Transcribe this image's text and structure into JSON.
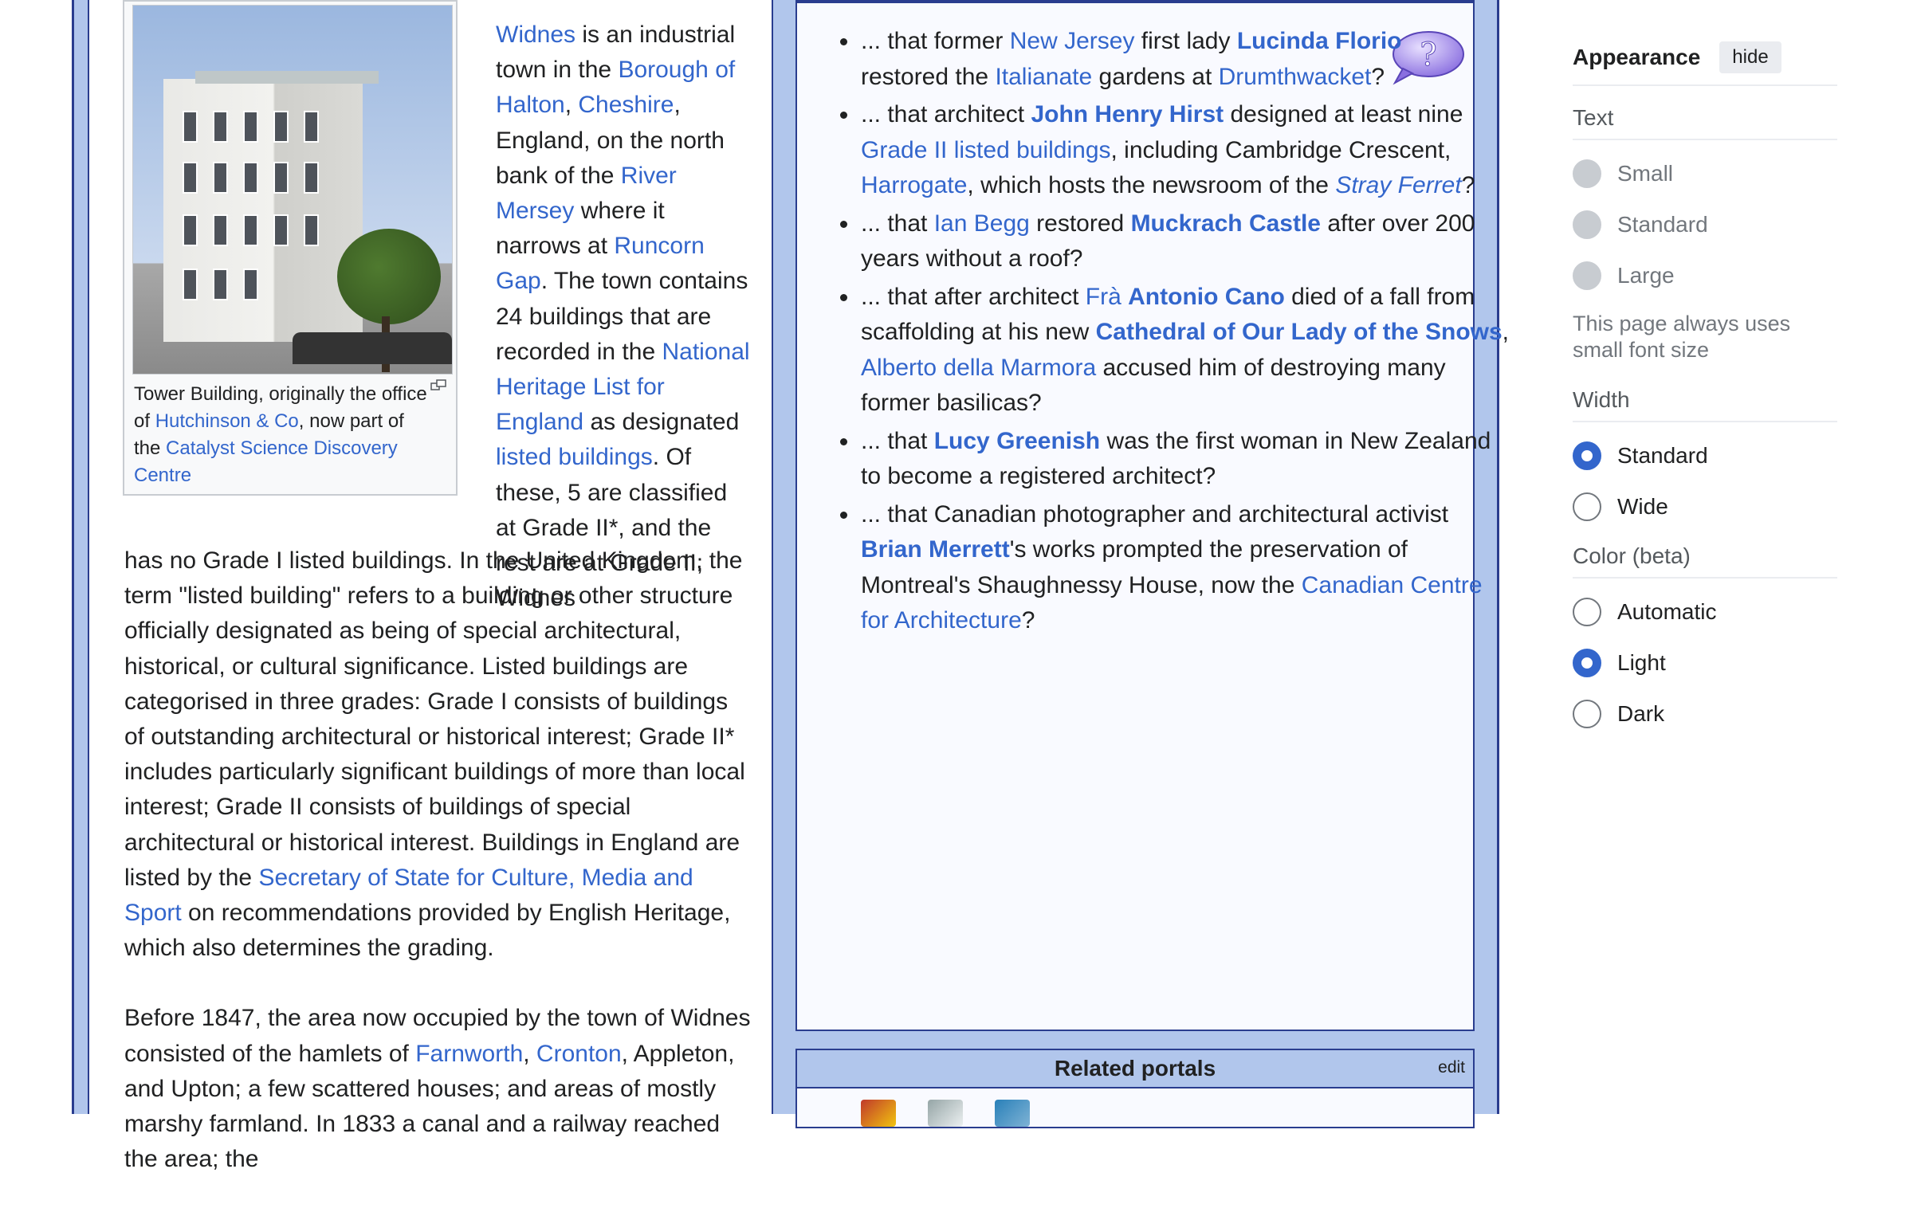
{
  "figure": {
    "caption_a": "Tower Building, originally the office of ",
    "caption_link1": "Hutchinson & Co",
    "caption_b": ", now part of the ",
    "caption_link2": "Catalyst Science Discovery Centre"
  },
  "lead": {
    "t1_link": "Widnes",
    "t1": " is an industrial town in the ",
    "t2_link": "Borough of Halton",
    "t2": ", ",
    "t3_link": "Cheshire",
    "t3": ", England, on the north bank of the ",
    "t4_link": "River Mersey",
    "t4": " where it narrows at ",
    "t5_link": "Runcorn Gap",
    "t5": ". The town contains 24 buildings that are recorded in the ",
    "t6_link": "National Heritage List for England",
    "t6": " as designated ",
    "t7_link": "listed buildings",
    "t7": ". Of these, 5 are classified at Grade II*, and the rest are at Grade II; Widnes"
  },
  "body": {
    "p1": "has no Grade I listed buildings. In the United Kingdom, the term \"listed building\" refers to a building or other structure officially designated as being of special architectural, historical, or cultural significance. Listed buildings are categorised in three grades: Grade I consists of buildings of outstanding architectural or historical interest; Grade II* includes particularly significant buildings of more than local interest; Grade II consists of buildings of special architectural or historical interest. Buildings in England are listed by the ",
    "p1_link": "Secretary of State for Culture, Media and Sport",
    "p1_end": " on recommendations provided by English Heritage, which also determines the grading.",
    "p2_a": "Before 1847, the area now occupied by the town of Widnes consisted of the hamlets of ",
    "p2_link1": "Farnworth",
    "p2_b": ", ",
    "p2_link2": "Cronton",
    "p2_c": ", Appleton, and Upton; a few scattered houses; and areas of mostly marshy farmland. In 1833 a canal and a railway reached the area; the"
  },
  "dyk": {
    "i1_a": "... that former ",
    "i1_l1": "New Jersey",
    "i1_b": " first lady ",
    "i1_l2": "Lucinda Florio",
    "i1_c": " restored the ",
    "i1_l3": "Italianate",
    "i1_d": " gardens at ",
    "i1_l4": "Drumthwacket",
    "i1_e": "?",
    "i2_a": "... that architect ",
    "i2_l1": "John Henry Hirst",
    "i2_b": " designed at least nine ",
    "i2_l2": "Grade II listed buildings",
    "i2_c": ", including Cambridge Crescent, ",
    "i2_l3": "Harrogate",
    "i2_d": ", which hosts the newsroom of the ",
    "i2_l4": "Stray Ferret",
    "i2_e": "?",
    "i3_a": "... that ",
    "i3_l1": "Ian Begg",
    "i3_b": " restored ",
    "i3_l2": "Muckrach Castle",
    "i3_c": " after over 200 years without a roof?",
    "i4_a": "... that after architect ",
    "i4_l1": "Frà",
    "i4_sp": " ",
    "i4_l2": "Antonio Cano",
    "i4_b": " died of a fall from scaffolding at his new ",
    "i4_l3": "Cathedral of Our Lady of the Snows",
    "i4_c": ", ",
    "i4_l4": "Alberto della Marmora",
    "i4_d": " accused him of destroying many former basilicas?",
    "i5_a": "... that ",
    "i5_l1": "Lucy Greenish",
    "i5_b": " was the first woman in New Zealand to become a registered architect?",
    "i6_a": "... that Canadian photographer and architectural activist ",
    "i6_l1": "Brian Merrett",
    "i6_b": "'s works prompted the preservation of Montreal's Shaughnessy House, now the ",
    "i6_l2": "Canadian Centre for Architecture",
    "i6_c": "?"
  },
  "related": {
    "title": "Related portals",
    "edit": "edit"
  },
  "appearance": {
    "title": "Appearance",
    "hide": "hide",
    "text_label": "Text",
    "text_small": "Small",
    "text_standard": "Standard",
    "text_large": "Large",
    "text_note": "This page always uses small font size",
    "width_label": "Width",
    "width_standard": "Standard",
    "width_wide": "Wide",
    "color_label": "Color (beta)",
    "color_automatic": "Automatic",
    "color_light": "Light",
    "color_dark": "Dark"
  }
}
